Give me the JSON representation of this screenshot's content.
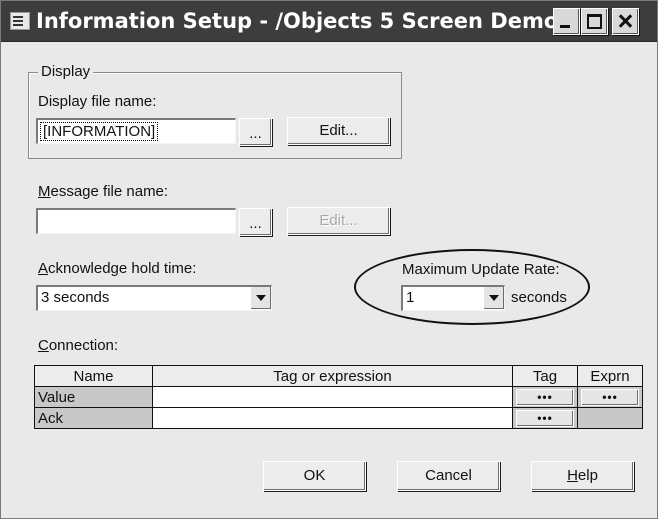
{
  "window": {
    "title": "Information Setup - /Objects 5 Screen Demo/",
    "icon": "dialog-app-icon"
  },
  "display": {
    "group_label": "Display",
    "file_label": "Display file name:",
    "file_value": "[INFORMATION]",
    "browse_label": "...",
    "edit_label": "Edit..."
  },
  "message": {
    "file_label_prefix": "",
    "file_label_accel": "M",
    "file_label_rest": "essage file name:",
    "file_value": "",
    "browse_label": "...",
    "edit_label": "Edit..."
  },
  "acknowledge": {
    "label_accel": "A",
    "label_rest": "cknowledge hold time:",
    "value": "3 seconds"
  },
  "update_rate": {
    "label": "Maximum Update Rate:",
    "value": "1",
    "unit": "seconds"
  },
  "connection": {
    "label_accel": "C",
    "label_rest": "onnection:",
    "headers": [
      "Name",
      "Tag or expression",
      "Tag",
      "Exprn"
    ],
    "rows": [
      {
        "name": "Value",
        "expression": "",
        "tag_btn": "•••",
        "exprn_btn": "•••"
      },
      {
        "name": "Ack",
        "expression": "",
        "tag_btn": "•••",
        "exprn_btn": ""
      }
    ]
  },
  "buttons": {
    "ok": "OK",
    "cancel": "Cancel",
    "help_accel": "H",
    "help_rest": "elp"
  }
}
